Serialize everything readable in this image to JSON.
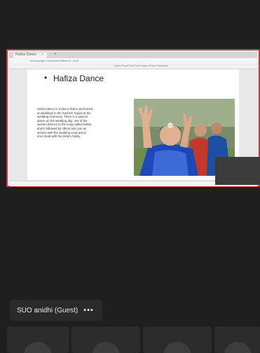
{
  "browser": {
    "tab_title": "Hafiza Dance",
    "tab_close": "×",
    "tab_add": "+",
    "url": "docs.google.com/presentation/d/.../edit",
    "bookmarks": "Apps   Gmail   YouTube   Maps   News   Translate"
  },
  "slide": {
    "bullet": "•",
    "title": "Hafiza Dance",
    "body": "Hafiza dance is a dance that is performed at weddings in the Kashmir region at the wedding ceremony. There is a special dance on the wedding day; one of the women dances to the song called Hafiza and is followed by others who join as women with the wedding song and a drum beat with the bride's family."
  },
  "participant": {
    "name": "SUO anidhi (Guest)",
    "more_label": "•••"
  },
  "colors": {
    "background": "#1f1f1f",
    "share_border": "#c9353f",
    "tile": "#2c2c2c"
  }
}
